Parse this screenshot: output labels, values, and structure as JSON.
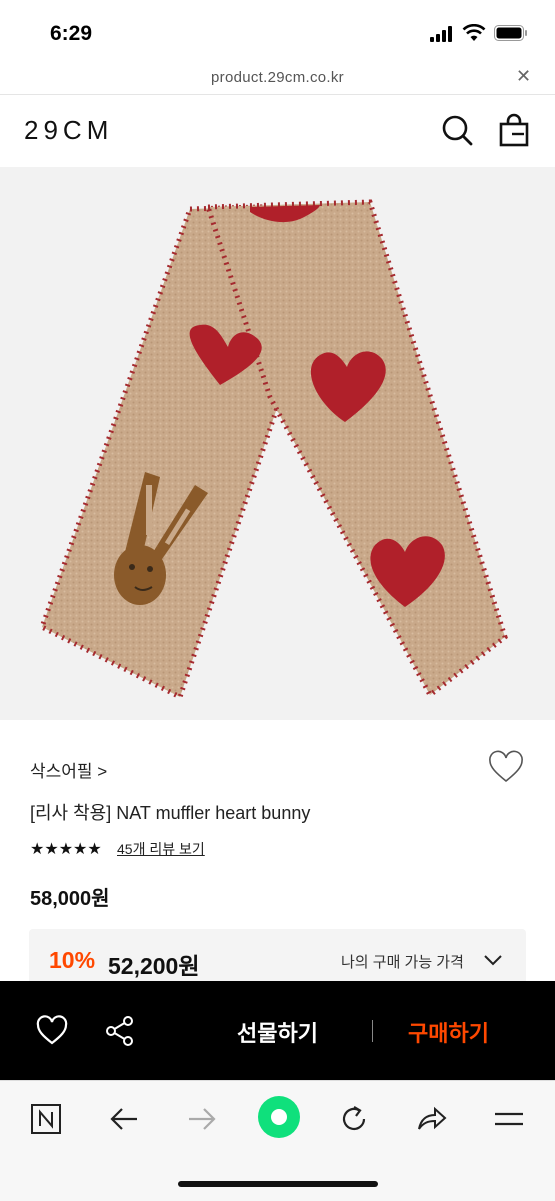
{
  "status": {
    "time": "6:29"
  },
  "browser": {
    "url": "product.29cm.co.kr"
  },
  "header": {
    "logo": "29CM"
  },
  "product": {
    "brand": "삭스어필 >",
    "name": "[리사 착용] NAT muffler heart bunny",
    "rating_stars": "★★★★★",
    "review_link": "45개 리뷰 보기",
    "price": "58,000원",
    "discount_rate": "10%",
    "discount_price": "52,200원",
    "my_price_label": "나의 구매 가능 가격"
  },
  "actions": {
    "gift_label": "선물하기",
    "buy_label": "구매하기"
  },
  "colors": {
    "accent": "#ff4800",
    "scarf_base": "#c9a98a",
    "heart_red": "#b0202a"
  }
}
